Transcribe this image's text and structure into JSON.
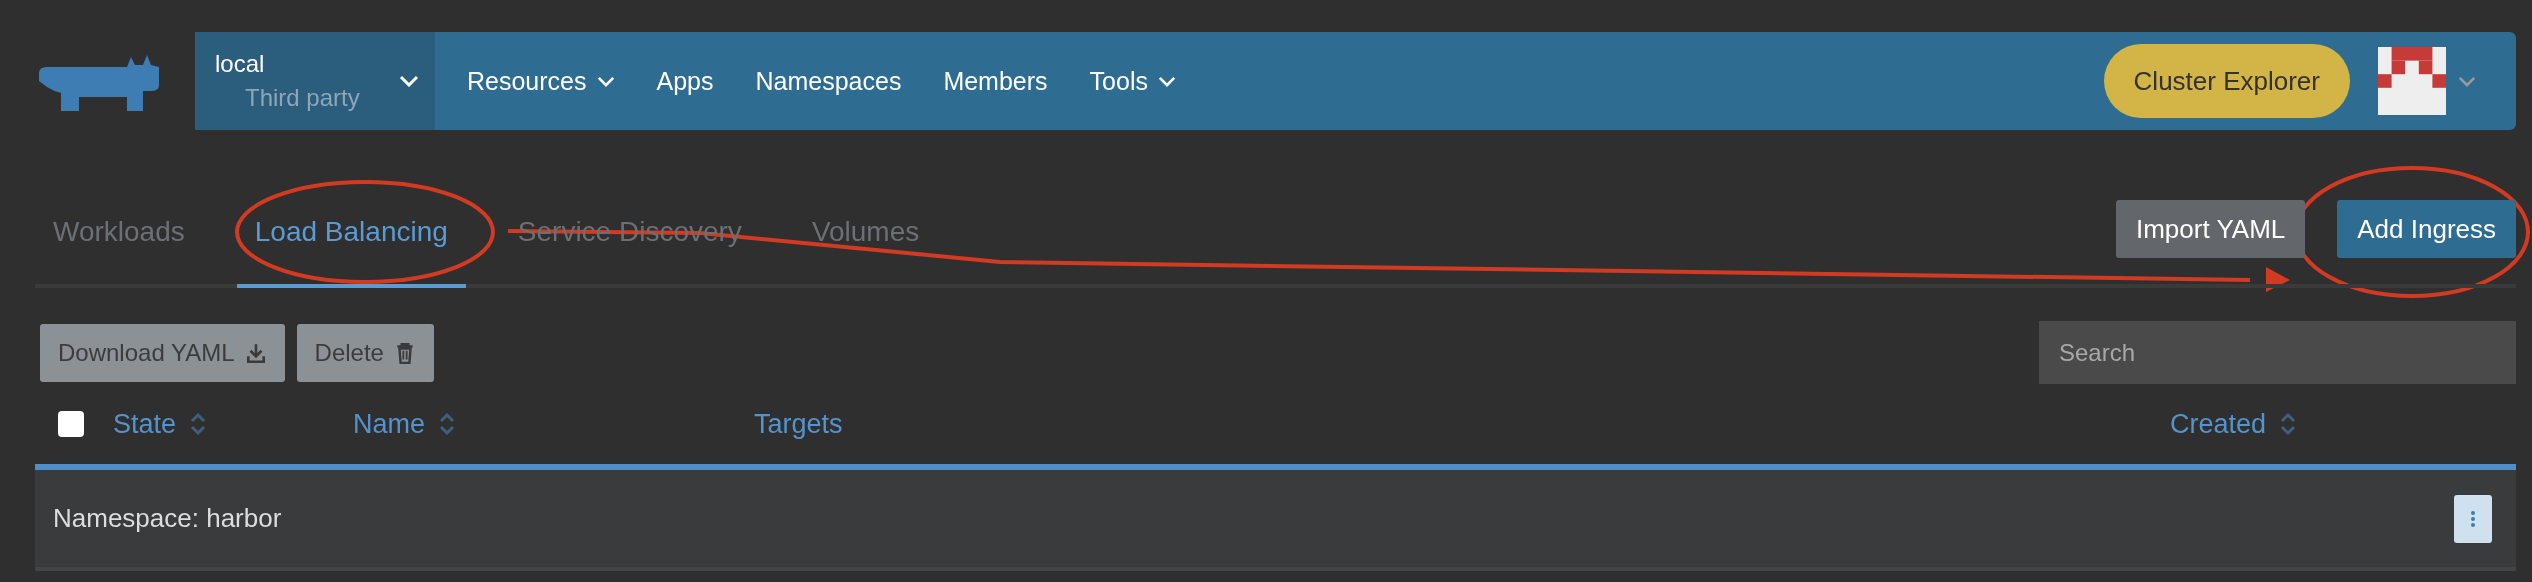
{
  "header": {
    "cluster": {
      "name": "local",
      "subtitle": "Third party"
    },
    "nav": [
      {
        "label": "Resources",
        "menu": true
      },
      {
        "label": "Apps",
        "menu": false
      },
      {
        "label": "Namespaces",
        "menu": false
      },
      {
        "label": "Members",
        "menu": false
      },
      {
        "label": "Tools",
        "menu": true
      }
    ],
    "cluster_explorer": "Cluster Explorer"
  },
  "tabs": [
    {
      "label": "Workloads",
      "selected": false
    },
    {
      "label": "Load Balancing",
      "selected": true
    },
    {
      "label": "Service Discovery",
      "selected": false
    },
    {
      "label": "Volumes",
      "selected": false
    }
  ],
  "page_actions": [
    {
      "label": "Import YAML",
      "kind": "secondary"
    },
    {
      "label": "Add Ingress",
      "kind": "primary"
    }
  ],
  "bulk_actions": [
    {
      "label": "Download YAML",
      "kind": "download"
    },
    {
      "label": "Delete",
      "kind": "delete"
    }
  ],
  "search": {
    "placeholder": "Search"
  },
  "table": {
    "select_all": {
      "checked": false
    },
    "columns": [
      {
        "label": "State",
        "sortable": true
      },
      {
        "label": "Name",
        "sortable": true
      },
      {
        "label": "Targets",
        "sortable": false
      },
      {
        "label": "Created",
        "sortable": true
      }
    ],
    "groups": [
      {
        "label": "Namespace: harbor"
      }
    ]
  }
}
